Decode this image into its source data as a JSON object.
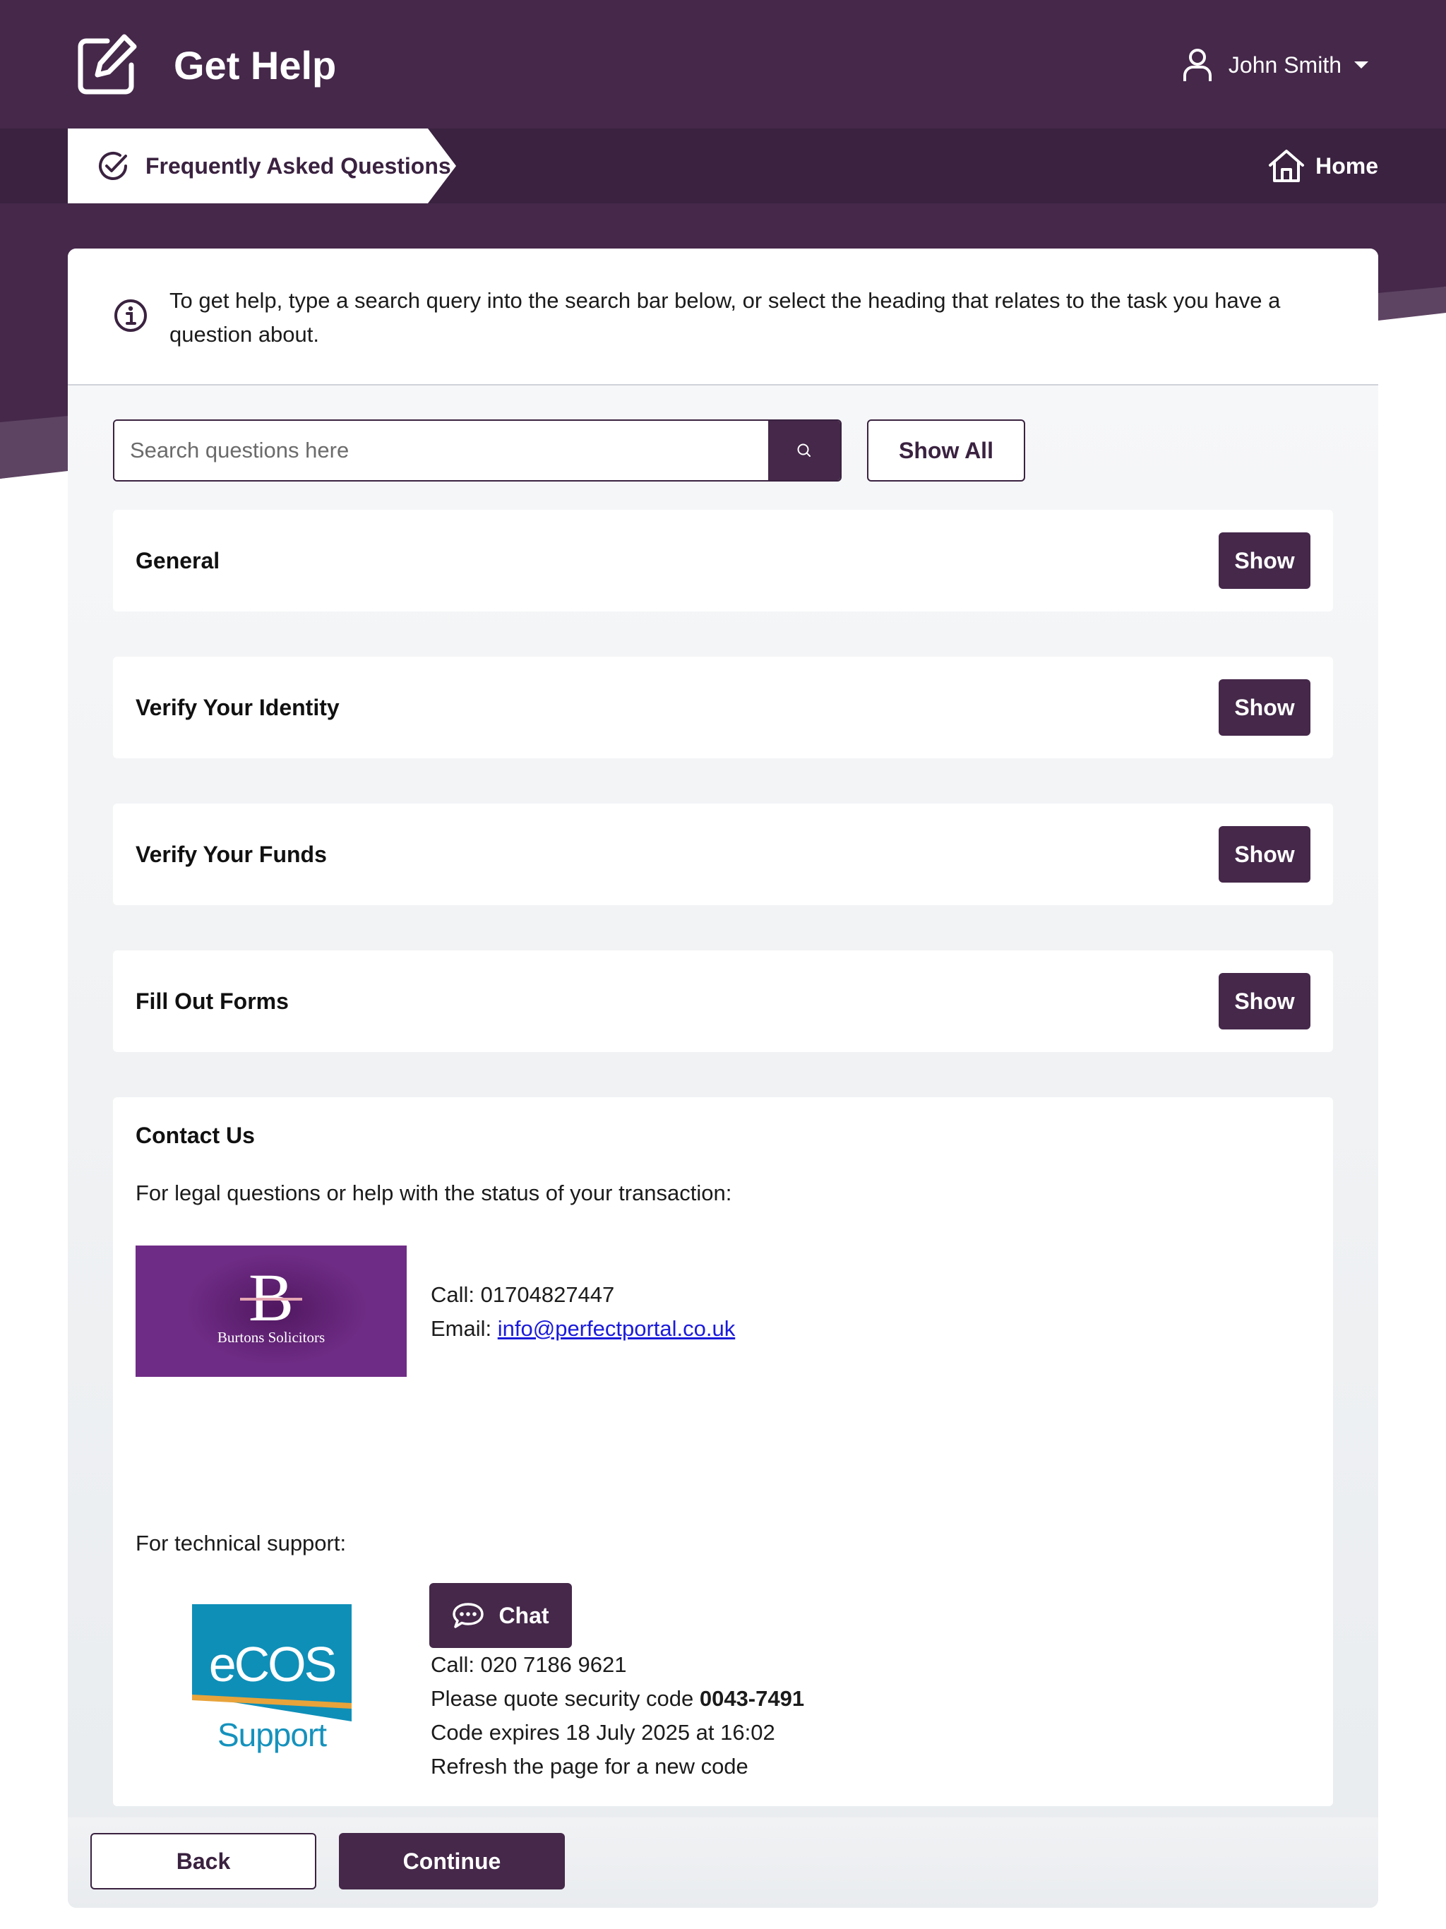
{
  "header": {
    "app_title": "Get Help",
    "app_icon": "edit-square-icon",
    "user_name": "John Smith",
    "user_icon": "user-icon"
  },
  "nav": {
    "breadcrumb": "Frequently Asked Questions",
    "breadcrumb_icon": "check-circle-icon",
    "home_label": "Home",
    "home_icon": "home-icon"
  },
  "info": {
    "text": "To get help, type a search query into the search bar below, or select the heading that relates to the task you have a question about.",
    "icon": "info-icon"
  },
  "search": {
    "placeholder": "Search questions here",
    "value": "",
    "show_all_label": "Show All"
  },
  "sections": [
    {
      "title": "General",
      "button": "Show"
    },
    {
      "title": "Verify Your Identity",
      "button": "Show"
    },
    {
      "title": "Verify Your Funds",
      "button": "Show"
    },
    {
      "title": "Fill Out Forms",
      "button": "Show"
    }
  ],
  "contact": {
    "title": "Contact Us",
    "legal_intro": "For legal questions or help with the status of your transaction:",
    "solicitor": {
      "logo_letter": "B",
      "logo_name": "Burtons Solicitors",
      "call": "Call: 01704827447",
      "email_label": "Email: ",
      "email": "info@perfectportal.co.uk"
    },
    "tech_intro": "For technical support:",
    "support": {
      "logo_text": "eCOS",
      "logo_sub": "Support",
      "chat_label": "Chat",
      "call": "Call: 020 7186 9621",
      "quote_prefix": "Please quote security code ",
      "code": "0043-7491",
      "expires": "Code expires 18 July 2025 at 16:02",
      "refresh": "Refresh the page for a new code"
    }
  },
  "footer": {
    "back_label": "Back",
    "continue_label": "Continue"
  },
  "colors": {
    "brand": "#45284a",
    "brand_dark": "#3a2240",
    "link": "#1a1adb"
  }
}
